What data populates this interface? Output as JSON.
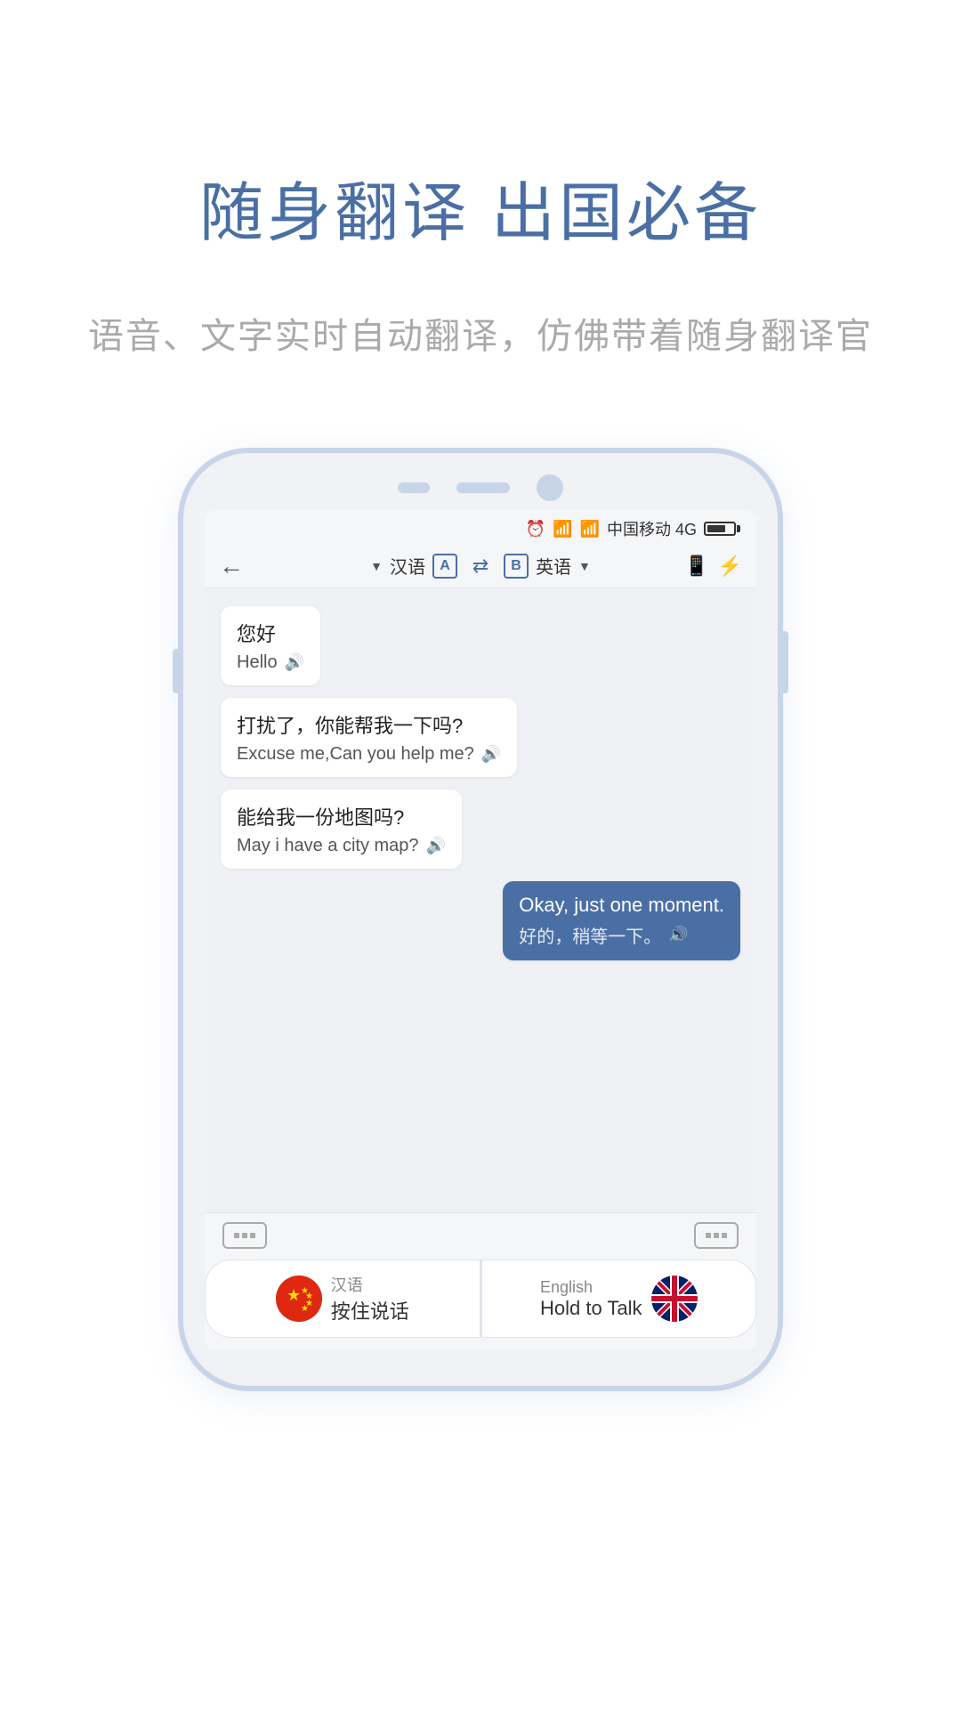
{
  "hero": {
    "title": "随身翻译 出国必备",
    "subtitle": "语音、文字实时自动翻译，仿佛带着随身翻译官"
  },
  "statusBar": {
    "carrier": "中国移动 4G"
  },
  "appHeader": {
    "langLeft": "汉语",
    "badgeLeft": "A",
    "swapIcon": "⇄",
    "badgeRight": "B",
    "langRight": "英语"
  },
  "chat": {
    "messages": [
      {
        "side": "left",
        "original": "您好",
        "translated": "Hello"
      },
      {
        "side": "left",
        "original": "打扰了，你能帮我一下吗?",
        "translated": "Excuse me,Can you help me?"
      },
      {
        "side": "left",
        "original": "能给我一份地图吗?",
        "translated": "May i have a city map?"
      },
      {
        "side": "right",
        "original": "Okay, just one moment.",
        "translated": "好的，稍等一下。"
      }
    ]
  },
  "bottomBar": {
    "chineseLang": "汉语",
    "chineseAction": "按住说话",
    "englishLang": "English",
    "englishAction": "Hold to Talk"
  }
}
